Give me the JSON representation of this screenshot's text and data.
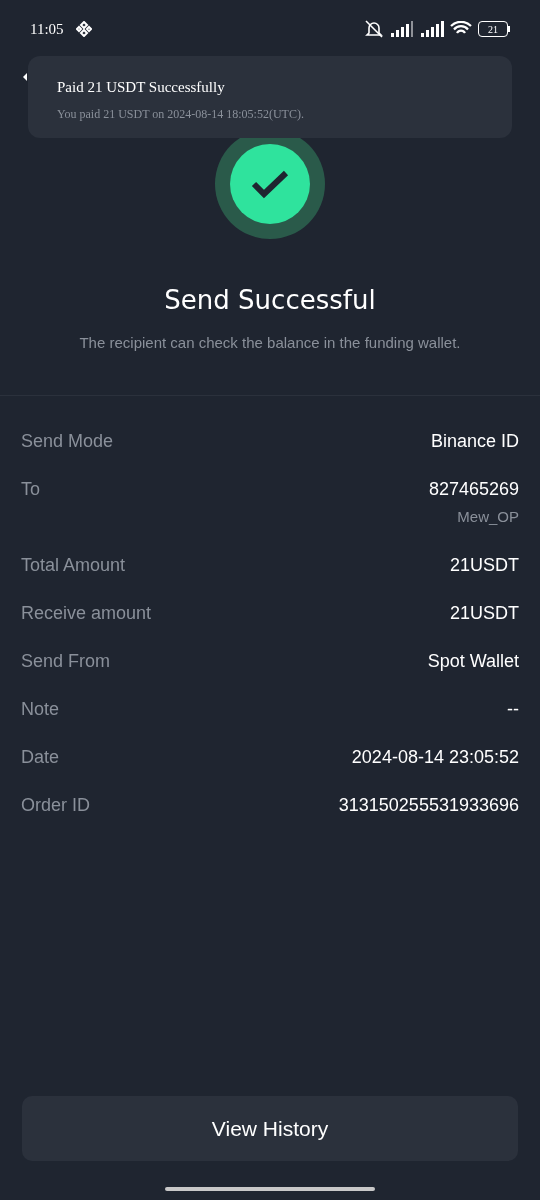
{
  "status_bar": {
    "time": "11:05",
    "battery": "21"
  },
  "notification": {
    "title": "Paid 21 USDT Successfully",
    "message": "You paid 21 USDT on 2024-08-14 18:05:52(UTC)."
  },
  "result": {
    "title": "Send Successful",
    "subtitle": "The recipient can check the balance in the funding wallet."
  },
  "details": [
    {
      "label": "Send Mode",
      "value": "Binance ID"
    },
    {
      "label": "To",
      "value": "827465269",
      "sub": "Mew_OP"
    },
    {
      "label": "Total Amount",
      "value": "21USDT"
    },
    {
      "label": "Receive amount",
      "value": "21USDT"
    },
    {
      "label": "Send From",
      "value": "Spot Wallet"
    },
    {
      "label": "Note",
      "value": "--"
    },
    {
      "label": "Date",
      "value": "2024-08-14 23:05:52"
    },
    {
      "label": "Order ID",
      "value": "313150255531933696"
    }
  ],
  "button": "View History"
}
